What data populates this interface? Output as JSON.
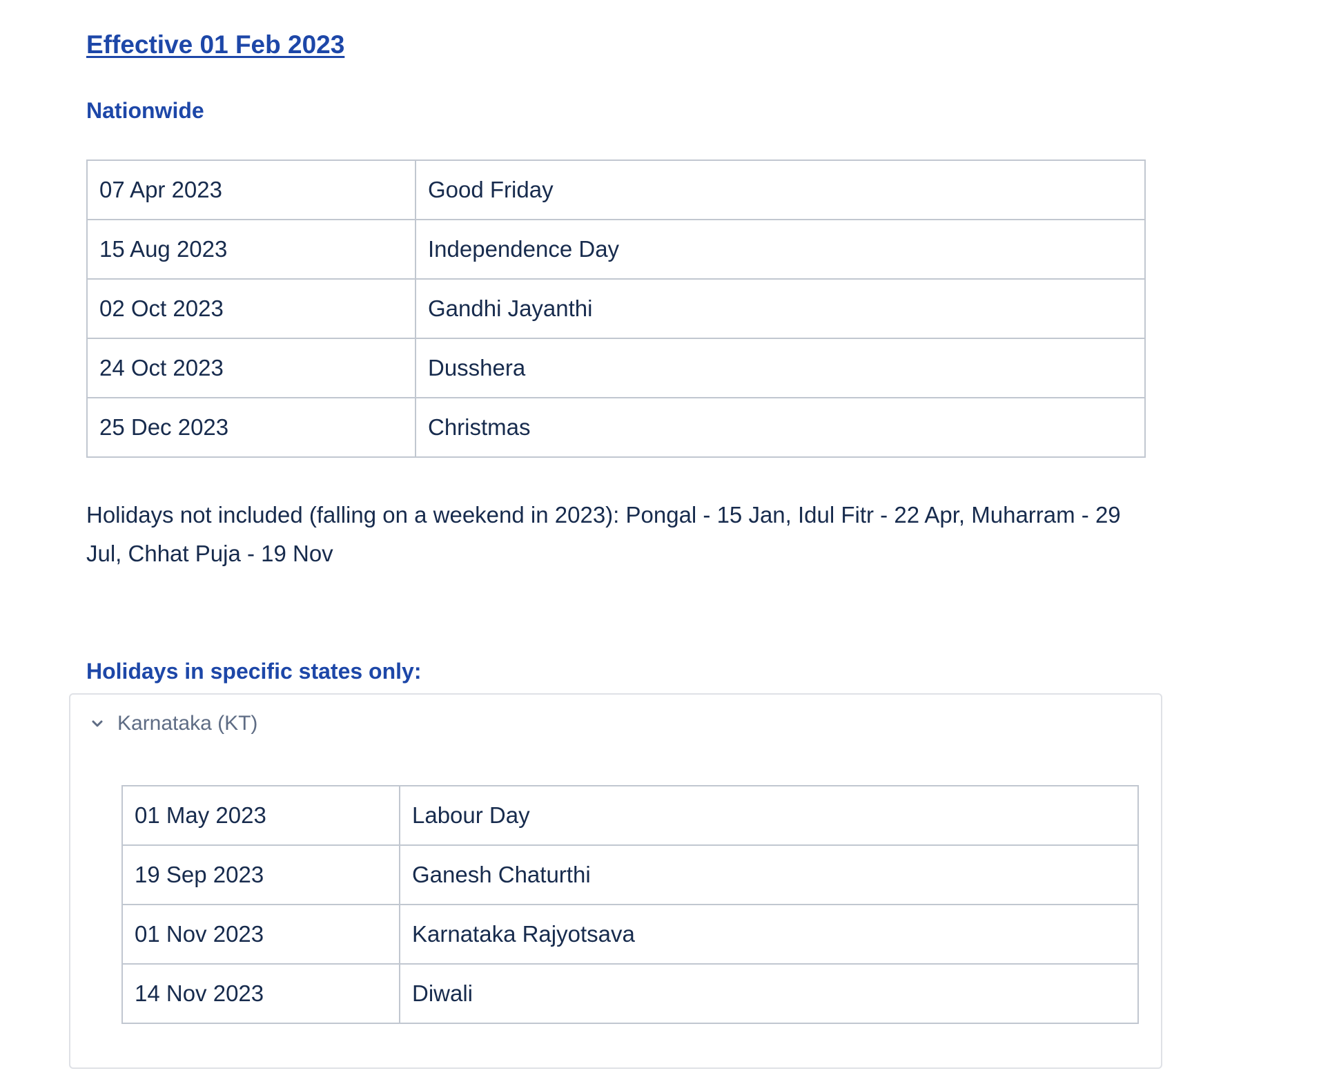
{
  "page": {
    "heading": "Effective 01 Feb 2023"
  },
  "nationwide": {
    "heading": "Nationwide",
    "rows": [
      {
        "date": "07 Apr 2023",
        "name": "Good Friday"
      },
      {
        "date": "15 Aug 2023",
        "name": "Independence Day"
      },
      {
        "date": "02 Oct 2023",
        "name": "Gandhi Jayanthi"
      },
      {
        "date": "24 Oct 2023",
        "name": "Dusshera"
      },
      {
        "date": "25 Dec 2023",
        "name": "Christmas"
      }
    ],
    "note": "Holidays not included (falling on a weekend in 2023): Pongal - 15 Jan, Idul Fitr - 22 Apr, Muharram - 29 Jul, Chhat Puja -  19 Nov"
  },
  "states": {
    "heading": "Holidays in specific states only:",
    "expand": {
      "label": "Karnataka (KT)",
      "icon": "chevron-down-icon",
      "expanded": true,
      "rows": [
        {
          "date": "01 May 2023",
          "name": "Labour Day"
        },
        {
          "date": "19 Sep 2023",
          "name": "Ganesh Chaturthi"
        },
        {
          "date": "01 Nov 2023",
          "name": "Karnataka Rajyotsava"
        },
        {
          "date": "14 Nov 2023",
          "name": "Diwali"
        }
      ]
    }
  },
  "colors": {
    "heading": "#1d47a8",
    "text": "#172b4d",
    "muted": "#5e6c84",
    "border": "#c1c7d0"
  }
}
